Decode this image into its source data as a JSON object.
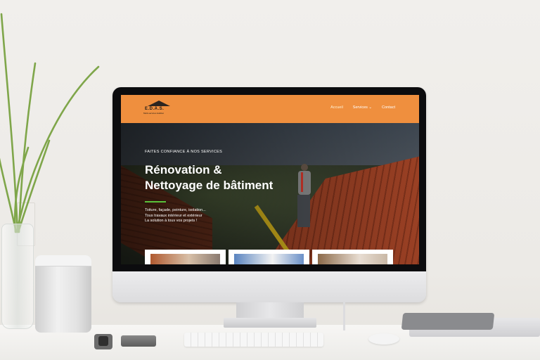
{
  "site": {
    "logo_text": "E.D.A.S.",
    "logo_subtext": "Multi-services Habitat",
    "nav": {
      "items": [
        {
          "label": "Accueil"
        },
        {
          "label": "Services"
        },
        {
          "label": "Contact"
        }
      ],
      "services_caret": "⌄"
    },
    "hero": {
      "kicker": "FAITES CONFIANCE À NOS SERVICES",
      "headline_line1": "Rénovation &",
      "headline_line2": "Nettoyage de bâtiment",
      "desc_line1": "Toiture, façade, peinture, isolation...",
      "desc_line2": "Tous travaux intérieur et extérieur",
      "desc_line3": "La solution à tous vos projets !"
    },
    "colors": {
      "nav_bg": "#ef8f3e",
      "accent_green": "#59c23a"
    }
  },
  "hardware": {
    "apple_logo": ""
  }
}
